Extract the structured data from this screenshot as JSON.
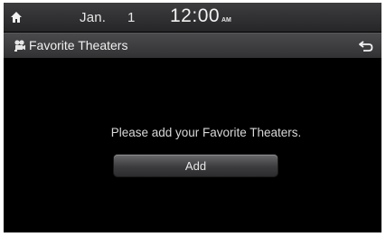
{
  "status_bar": {
    "home_icon": "home-icon",
    "date": "Jan.",
    "day": "1",
    "time": "12:00",
    "ampm": "AM"
  },
  "title_bar": {
    "icon": "theater-icon",
    "title": "Favorite Theaters",
    "back_icon": "back-arrow-icon"
  },
  "content": {
    "message": "Please add your Favorite Theaters.",
    "add_label": "Add"
  },
  "colors": {
    "background": "#000000",
    "bar": "#3d3d3f",
    "text": "#e6e6e6"
  }
}
